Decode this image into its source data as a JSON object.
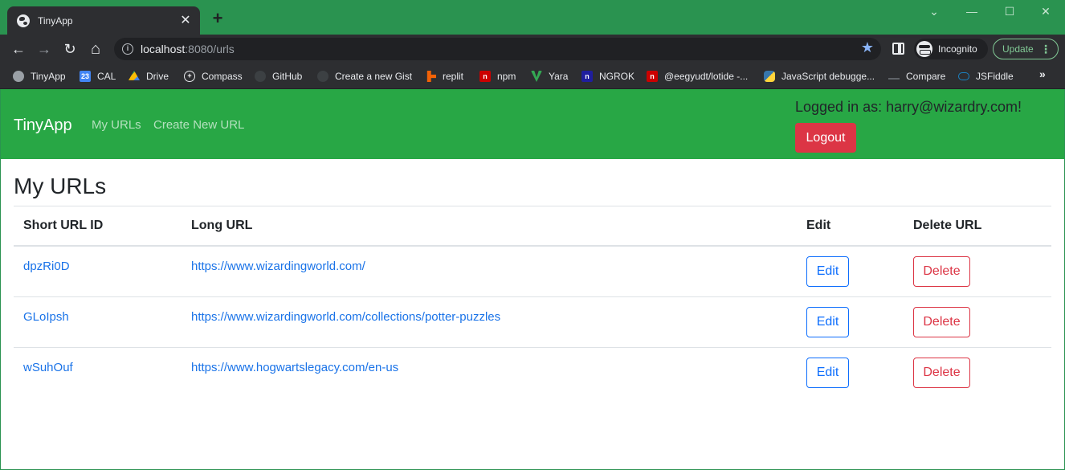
{
  "browser": {
    "tab_title": "TinyApp",
    "tab_close": "✕",
    "new_tab": "+",
    "window_controls": {
      "minimize": "—",
      "maximize": "☐",
      "close": "✕"
    },
    "nav": {
      "back": "←",
      "forward": "→",
      "reload": "↻",
      "home": "⌂"
    },
    "url_host": "localhost",
    "url_rest": ":8080/urls",
    "info_glyph": "i",
    "star_glyph": "★",
    "incognito_label": "Incognito",
    "update_label": "Update",
    "update_menu": "⋮",
    "bookmarks": [
      {
        "label": "TinyApp",
        "icon": "globe-icon",
        "color": "#9aa0a6"
      },
      {
        "label": "CAL",
        "icon": "calendar-icon",
        "color": "#4285f4"
      },
      {
        "label": "Drive",
        "icon": "drive-icon",
        "color": "#fbbc04"
      },
      {
        "label": "Compass",
        "icon": "compass-icon",
        "color": "#e8eaed"
      },
      {
        "label": "GitHub",
        "icon": "github-icon",
        "color": "#3c4043"
      },
      {
        "label": "Create a new Gist",
        "icon": "github-icon",
        "color": "#3c4043"
      },
      {
        "label": "replit",
        "icon": "replit-icon",
        "color": "#f26207"
      },
      {
        "label": "npm",
        "icon": "npm-icon",
        "color": "#cb0000"
      },
      {
        "label": "Yara",
        "icon": "yara-icon",
        "color": "#34a853"
      },
      {
        "label": "NGROK",
        "icon": "ngrok-icon",
        "color": "#1f1e9e"
      },
      {
        "label": "@eegyudt/lotide -...",
        "icon": "npm-icon",
        "color": "#cb0000"
      },
      {
        "label": "JavaScript debugge...",
        "icon": "python-icon",
        "color": "#3776ab"
      },
      {
        "label": "Compare",
        "icon": "compare-icon",
        "color": "#5f6368"
      },
      {
        "label": "JSFiddle",
        "icon": "jsfiddle-icon",
        "color": "#1a82c3"
      }
    ],
    "bookmarks_more": "»"
  },
  "navbar": {
    "brand": "TinyApp",
    "links": [
      "My URLs",
      "Create New URL"
    ],
    "login_text": "Logged in as: harry@wizardry.com!",
    "logout_label": "Logout"
  },
  "main": {
    "title": "My URLs",
    "columns": [
      "Short URL ID",
      "Long URL",
      "Edit",
      "Delete URL"
    ],
    "rows": [
      {
        "short_id": "dpzRi0D",
        "long_url": "https://www.wizardingworld.com/",
        "edit_label": "Edit",
        "delete_label": "Delete"
      },
      {
        "short_id": "GLoIpsh",
        "long_url": "https://www.wizardingworld.com/collections/potter-puzzles",
        "edit_label": "Edit",
        "delete_label": "Delete"
      },
      {
        "short_id": "wSuhOuf",
        "long_url": "https://www.hogwartslegacy.com/en-us",
        "edit_label": "Edit",
        "delete_label": "Delete"
      }
    ]
  },
  "colors": {
    "navbar_green": "#28a745",
    "danger": "#dc3545",
    "primary": "#0d6efd",
    "link": "#1a73e8"
  }
}
